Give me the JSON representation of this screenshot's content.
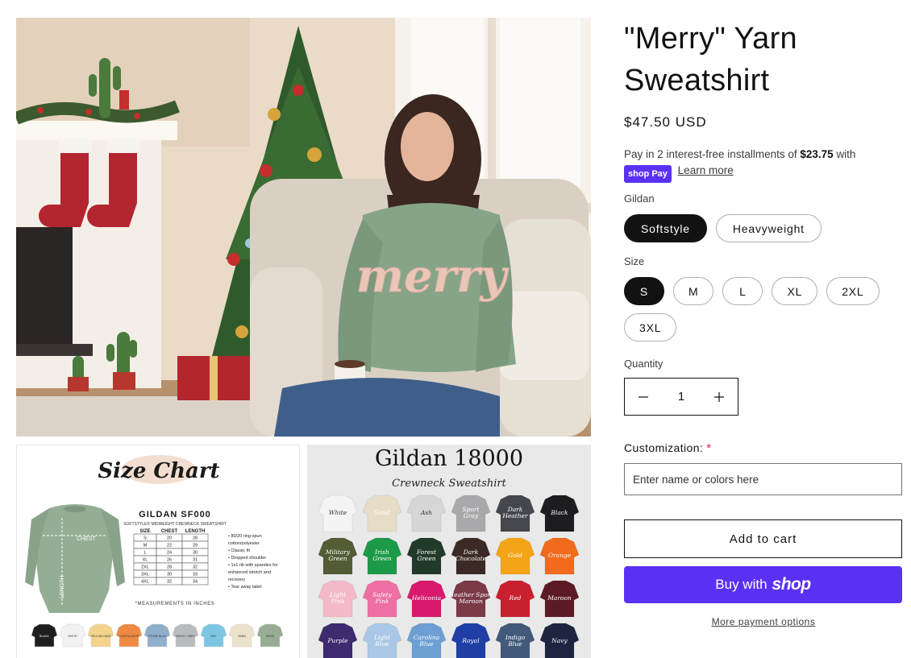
{
  "product": {
    "title_line1": "\"Merry\" Yarn",
    "title_line2": "Sweatshirt",
    "price": "$47.50 USD"
  },
  "installments": {
    "prefix": "Pay in 2 interest-free installments of",
    "amount": "$23.75",
    "suffix": "with",
    "badge": "shop Pay",
    "learn_more": "Learn more"
  },
  "options": {
    "brand": {
      "label": "Gildan",
      "values": [
        "Softstyle",
        "Heavyweight"
      ],
      "selected": "Softstyle"
    },
    "size": {
      "label": "Size",
      "values": [
        "S",
        "M",
        "L",
        "XL",
        "2XL",
        "3XL"
      ],
      "selected": "S"
    }
  },
  "quantity": {
    "label": "Quantity",
    "value": "1",
    "decrease_icon": "minus-icon",
    "increase_icon": "plus-icon"
  },
  "customization": {
    "label": "Customization:",
    "required_mark": "*",
    "placeholder": "Enter name or colors here"
  },
  "buttons": {
    "add_to_cart": "Add to cart",
    "buy_with": "Buy with",
    "shop_word": "shop",
    "more_payment": "More payment options"
  },
  "media": {
    "size_chart": {
      "title": "Size Chart",
      "model": "GILDAN SF000",
      "subtitle": "SOFTSTYLE® MIDWEIGHT CREWNECK SWEATSHIRT",
      "chest_label": "CHEST",
      "length_label": "LENGTH",
      "table_headers": [
        "SIZE",
        "CHEST",
        "LENGTH"
      ],
      "table_rows": [
        [
          "S",
          "20",
          "28"
        ],
        [
          "M",
          "22",
          "29"
        ],
        [
          "L",
          "24",
          "30"
        ],
        [
          "XL",
          "26",
          "31"
        ],
        [
          "2XL",
          "28",
          "32"
        ],
        [
          "3XL",
          "30",
          "33"
        ],
        [
          "4XL",
          "32",
          "34"
        ]
      ],
      "features": [
        "• 80/20 ring-spun",
        "cotton/polyester",
        "• Classic fit",
        "• Dropped shoulder",
        "• 1x1 rib with spandex for",
        "enhanced stretch and",
        "recovery",
        "• Tear away label"
      ],
      "note": "*MEASUREMENTS IN INCHES",
      "swatch_labels": [
        "BLACK",
        "WHITE",
        "YELLOW HAZE",
        "CANTALOUPE",
        "STONE BLUE",
        "HEATH. GREY",
        "SKY",
        "SAND",
        "SAGE"
      ]
    },
    "color_chart": {
      "title": "Gildan 18000",
      "subtitle": "Crewneck Sweatshirt",
      "colors": [
        {
          "name": "White",
          "hex": "#f4f4f4",
          "text": "#333333"
        },
        {
          "name": "Sand",
          "hex": "#e7dcc6",
          "text": "#ffffff"
        },
        {
          "name": "Ash",
          "hex": "#d6d6d6",
          "text": "#333333"
        },
        {
          "name": "Sport Gray",
          "hex": "#a9a9ab",
          "text": "#ffffff"
        },
        {
          "name": "Dark Heather",
          "hex": "#45474c",
          "text": "#ffffff"
        },
        {
          "name": "Black",
          "hex": "#1d1d1f",
          "text": "#ffffff"
        },
        {
          "name": "Military Green",
          "hex": "#535c35",
          "text": "#ffffff"
        },
        {
          "name": "Irish Green",
          "hex": "#1d9a48",
          "text": "#ffffff"
        },
        {
          "name": "Forest Green",
          "hex": "#213a2a",
          "text": "#ffffff"
        },
        {
          "name": "Dark Chocolate",
          "hex": "#3b2a24",
          "text": "#ffffff"
        },
        {
          "name": "Gold",
          "hex": "#f3a517",
          "text": "#ffffff"
        },
        {
          "name": "Orange",
          "hex": "#f26b1d",
          "text": "#ffffff"
        },
        {
          "name": "Light Pink",
          "hex": "#f4b9c9",
          "text": "#ffffff"
        },
        {
          "name": "Safety Pink",
          "hex": "#ee6fa3",
          "text": "#ffffff"
        },
        {
          "name": "Heliconia",
          "hex": "#d8196c",
          "text": "#ffffff"
        },
        {
          "name": "Heather Sport Maroon",
          "hex": "#7a3a46",
          "text": "#ffffff"
        },
        {
          "name": "Red",
          "hex": "#c8202f",
          "text": "#ffffff"
        },
        {
          "name": "Maroon",
          "hex": "#5c1a24",
          "text": "#ffffff"
        },
        {
          "name": "Purple",
          "hex": "#3e2a6e",
          "text": "#ffffff"
        },
        {
          "name": "Light Blue",
          "hex": "#a9c8e6",
          "text": "#ffffff"
        },
        {
          "name": "Carolina Blue",
          "hex": "#6e9fd4",
          "text": "#ffffff"
        },
        {
          "name": "Royal",
          "hex": "#1f3fa6",
          "text": "#ffffff"
        },
        {
          "name": "Indigo Blue",
          "hex": "#42597a",
          "text": "#ffffff"
        },
        {
          "name": "Navy",
          "hex": "#1e2540",
          "text": "#ffffff"
        }
      ]
    }
  },
  "colors": {
    "accent": "#5a31f4",
    "text": "#121212",
    "selected_pill": "#121212"
  }
}
